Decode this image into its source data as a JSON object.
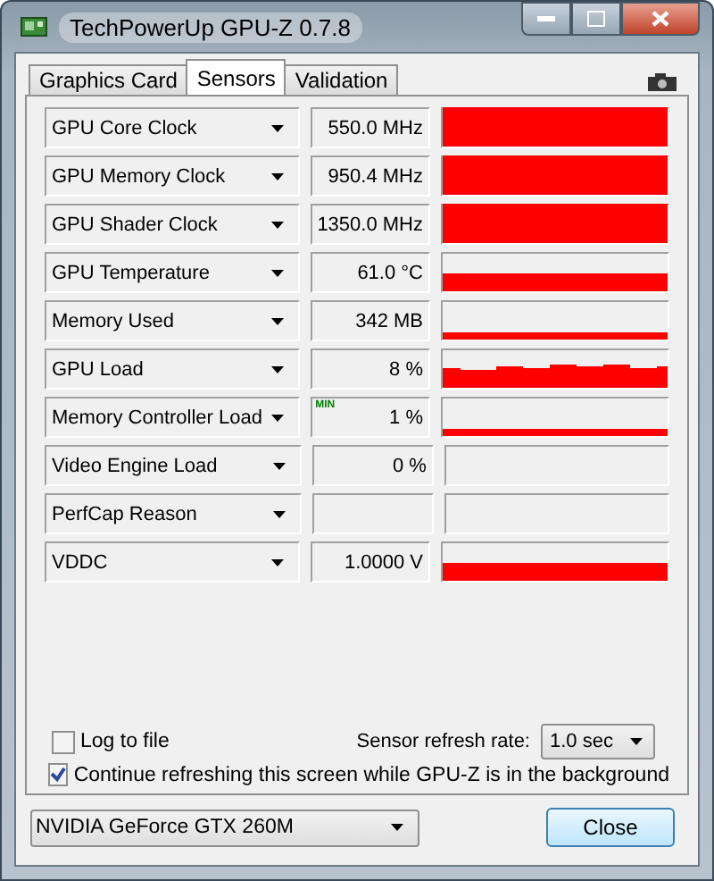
{
  "window": {
    "title": "TechPowerUp GPU-Z 0.7.8"
  },
  "tabs": [
    {
      "label": "Graphics Card",
      "selected": false
    },
    {
      "label": "Sensors",
      "selected": true
    },
    {
      "label": "Validation",
      "selected": false
    }
  ],
  "sensors": [
    {
      "name": "GPU Core Clock",
      "value": "550.0 MHz",
      "kind": "full"
    },
    {
      "name": "GPU Memory Clock",
      "value": "950.4 MHz",
      "kind": "full"
    },
    {
      "name": "GPU Shader Clock",
      "value": "1350.0 MHz",
      "kind": "full"
    },
    {
      "name": "GPU Temperature",
      "value": "61.0 °C",
      "kind": "mid"
    },
    {
      "name": "Memory Used",
      "value": "342 MB",
      "kind": "low"
    },
    {
      "name": "GPU Load",
      "value": "8 %",
      "kind": "noisy"
    },
    {
      "name": "Memory Controller Load",
      "value": "1 %",
      "tag": "MIN",
      "kind": "low"
    },
    {
      "name": "Video Engine Load",
      "value": "0 %",
      "kind": "empty"
    },
    {
      "name": "PerfCap Reason",
      "kind": "empty"
    },
    {
      "name": "VDDC",
      "value": "1.0000 V",
      "kind": "mid"
    }
  ],
  "log_to_file": {
    "label": "Log to file",
    "checked": false
  },
  "refresh_rate": {
    "label": "Sensor refresh rate:",
    "value": "1.0 sec"
  },
  "continue_refreshing": {
    "label": "Continue refreshing this screen while GPU-Z is in the background",
    "checked": true
  },
  "gpu_select": {
    "value": "NVIDIA GeForce GTX 260M"
  },
  "buttons": [
    "Close"
  ]
}
